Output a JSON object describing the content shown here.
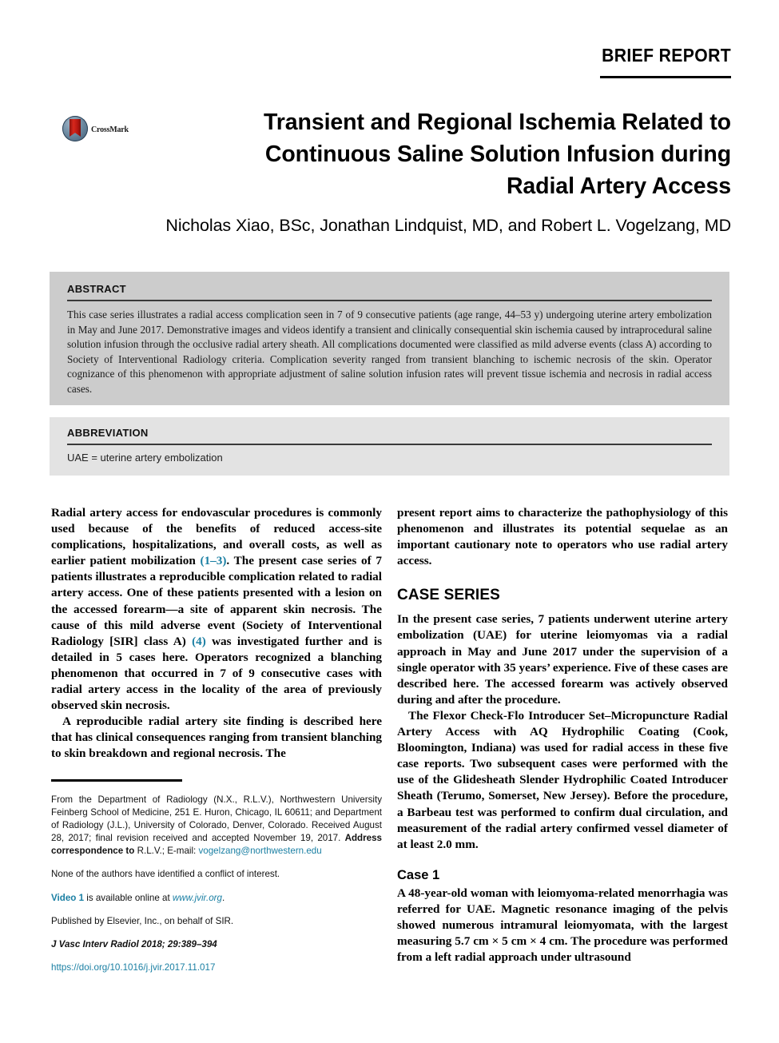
{
  "header": {
    "running_head": "BRIEF REPORT"
  },
  "logo": {
    "name": "CrossMark",
    "label": "CrossMark"
  },
  "article": {
    "title_line1": "Transient and Regional Ischemia Related to",
    "title_line2": "Continuous Saline Solution Infusion during",
    "title_line3": "Radial Artery Access",
    "authors": "Nicholas Xiao, BSc, Jonathan Lindquist, MD, and Robert L. Vogelzang, MD"
  },
  "abstract": {
    "heading": "ABSTRACT",
    "text": "This case series illustrates a radial access complication seen in 7 of 9 consecutive patients (age range, 44–53 y) undergoing uterine artery embolization in May and June 2017. Demonstrative images and videos identify a transient and clinically consequential skin ischemia caused by intraprocedural saline solution infusion through the occlusive radial artery sheath. All complications documented were classified as mild adverse events (class A) according to Society of Interventional Radiology criteria. Complication severity ranged from transient blanching to ischemic necrosis of the skin. Operator cognizance of this phenomenon with appropriate adjustment of saline solution infusion rates will prevent tissue ischemia and necrosis in radial access cases."
  },
  "abbreviation": {
    "heading": "ABBREVIATION",
    "text": "UAE = uterine artery embolization"
  },
  "body": {
    "left_para_1_a": "Radial artery access for endovascular procedures is commonly used because of the benefits of reduced access-site complications, hospitalizations, and overall costs, as well as earlier patient mobilization ",
    "left_para_1_ref1": "(1–3)",
    "left_para_1_b": ". The present case series of 7 patients illustrates a reproducible complication related to radial artery access. One of these patients presented with a lesion on the accessed forearm—a site of apparent skin necrosis. The cause of this mild adverse event (Society of Interventional Radiology [SIR] class A) ",
    "left_para_1_ref2": "(4)",
    "left_para_1_c": " was investigated further and is detailed in 5 cases here. Operators recognized a blanching phenomenon that occurred in 7 of 9 consecutive cases with radial artery access in the locality of the area of previously observed skin necrosis.",
    "left_para_2": "A reproducible radial artery site finding is described here that has clinical consequences ranging from transient blanching to skin breakdown and regional necrosis. The",
    "right_para_1": "present report aims to characterize the pathophysiology of this phenomenon and illustrates its potential sequelae as an important cautionary note to operators who use radial artery access.",
    "case_series_heading": "CASE SERIES",
    "right_para_2": "In the present case series, 7 patients underwent uterine artery embolization (UAE) for uterine leiomyomas via a radial approach in May and June 2017 under the supervision of a single operator with 35 years’ experience. Five of these cases are described here. The accessed forearm was actively observed during and after the procedure.",
    "right_para_3": "The Flexor Check-Flo Introducer Set–Micropuncture Radial Artery Access with AQ Hydrophilic Coating (Cook, Bloomington, Indiana) was used for radial access in these five case reports. Two subsequent cases were performed with the use of the Glidesheath Slender Hydrophilic Coated Introducer Sheath (Terumo, Somerset, New Jersey). Before the procedure, a Barbeau test was performed to confirm dual circulation, and measurement of the radial artery confirmed vessel diameter of at least 2.0 mm.",
    "case1_heading": "Case 1",
    "case1_para": "A 48-year-old woman with leiomyoma-related menorrhagia was referred for UAE. Magnetic resonance imaging of the pelvis showed numerous intramural leiomyomata, with the largest measuring 5.7 cm × 5 cm × 4 cm. The procedure was performed from a left radial approach under ultrasound"
  },
  "footnotes": {
    "affiliation_a": "From the Department of Radiology (N.X., R.L.V.), Northwestern University Feinberg School of Medicine, 251 E. Huron, Chicago, IL 60611; and Department of Radiology (J.L.), University of Colorado, Denver, Colorado. Received August 28, 2017; final revision received and accepted November 19, 2017. ",
    "affiliation_bold": "Address correspondence to",
    "affiliation_b": " R.L.V.; E-mail: ",
    "email": "vogelzang@northwestern.edu",
    "conflict": "None of the authors have identified a conflict of interest.",
    "video_label": "Video 1",
    "video_text": " is available online at ",
    "video_url": "www.jvir.org",
    "video_period": ".",
    "publisher": "Published by Elsevier, Inc., on behalf of SIR.",
    "citation": "J Vasc Interv Radiol 2018; 29:389–394",
    "doi": "https://doi.org/10.1016/j.jvir.2017.11.017"
  },
  "colors": {
    "link": "#1a7fa3",
    "abstract_bg": "#cccccc",
    "abbreviation_bg": "#e3e3e3",
    "rule": "#000000"
  }
}
